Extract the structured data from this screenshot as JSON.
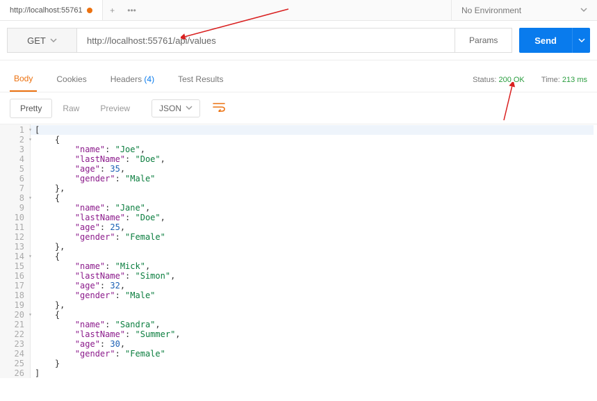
{
  "tab": {
    "title": "http://localhost:55761",
    "dirty": true
  },
  "environment": {
    "selected": "No Environment"
  },
  "request": {
    "method": "GET",
    "url": "http://localhost:55761/api/values",
    "params_btn": "Params",
    "send_btn": "Send"
  },
  "response_tabs": {
    "body": "Body",
    "cookies": "Cookies",
    "headers": "Headers",
    "headers_count": "(4)",
    "tests": "Test Results"
  },
  "status": {
    "status_label": "Status:",
    "status_value": "200 OK",
    "time_label": "Time:",
    "time_value": "213 ms"
  },
  "view": {
    "pretty": "Pretty",
    "raw": "Raw",
    "preview": "Preview",
    "format": "JSON"
  },
  "body_lines": [
    {
      "n": 1,
      "fold": true,
      "indent": 0,
      "raw": "["
    },
    {
      "n": 2,
      "fold": true,
      "indent": 1,
      "raw": "{"
    },
    {
      "n": 3,
      "fold": false,
      "indent": 2,
      "key": "name",
      "val": "Joe",
      "type": "string",
      "comma": true
    },
    {
      "n": 4,
      "fold": false,
      "indent": 2,
      "key": "lastName",
      "val": "Doe",
      "type": "string",
      "comma": true
    },
    {
      "n": 5,
      "fold": false,
      "indent": 2,
      "key": "age",
      "val": 35,
      "type": "number",
      "comma": true
    },
    {
      "n": 6,
      "fold": false,
      "indent": 2,
      "key": "gender",
      "val": "Male",
      "type": "string",
      "comma": false
    },
    {
      "n": 7,
      "fold": false,
      "indent": 1,
      "raw": "},"
    },
    {
      "n": 8,
      "fold": true,
      "indent": 1,
      "raw": "{"
    },
    {
      "n": 9,
      "fold": false,
      "indent": 2,
      "key": "name",
      "val": "Jane",
      "type": "string",
      "comma": true
    },
    {
      "n": 10,
      "fold": false,
      "indent": 2,
      "key": "lastName",
      "val": "Doe",
      "type": "string",
      "comma": true
    },
    {
      "n": 11,
      "fold": false,
      "indent": 2,
      "key": "age",
      "val": 25,
      "type": "number",
      "comma": true
    },
    {
      "n": 12,
      "fold": false,
      "indent": 2,
      "key": "gender",
      "val": "Female",
      "type": "string",
      "comma": false
    },
    {
      "n": 13,
      "fold": false,
      "indent": 1,
      "raw": "},"
    },
    {
      "n": 14,
      "fold": true,
      "indent": 1,
      "raw": "{"
    },
    {
      "n": 15,
      "fold": false,
      "indent": 2,
      "key": "name",
      "val": "Mick",
      "type": "string",
      "comma": true
    },
    {
      "n": 16,
      "fold": false,
      "indent": 2,
      "key": "lastName",
      "val": "Simon",
      "type": "string",
      "comma": true
    },
    {
      "n": 17,
      "fold": false,
      "indent": 2,
      "key": "age",
      "val": 32,
      "type": "number",
      "comma": true
    },
    {
      "n": 18,
      "fold": false,
      "indent": 2,
      "key": "gender",
      "val": "Male",
      "type": "string",
      "comma": false
    },
    {
      "n": 19,
      "fold": false,
      "indent": 1,
      "raw": "},"
    },
    {
      "n": 20,
      "fold": true,
      "indent": 1,
      "raw": "{"
    },
    {
      "n": 21,
      "fold": false,
      "indent": 2,
      "key": "name",
      "val": "Sandra",
      "type": "string",
      "comma": true
    },
    {
      "n": 22,
      "fold": false,
      "indent": 2,
      "key": "lastName",
      "val": "Summer",
      "type": "string",
      "comma": true
    },
    {
      "n": 23,
      "fold": false,
      "indent": 2,
      "key": "age",
      "val": 30,
      "type": "number",
      "comma": true
    },
    {
      "n": 24,
      "fold": false,
      "indent": 2,
      "key": "gender",
      "val": "Female",
      "type": "string",
      "comma": false
    },
    {
      "n": 25,
      "fold": false,
      "indent": 1,
      "raw": "}"
    },
    {
      "n": 26,
      "fold": false,
      "indent": 0,
      "raw": "]"
    }
  ]
}
